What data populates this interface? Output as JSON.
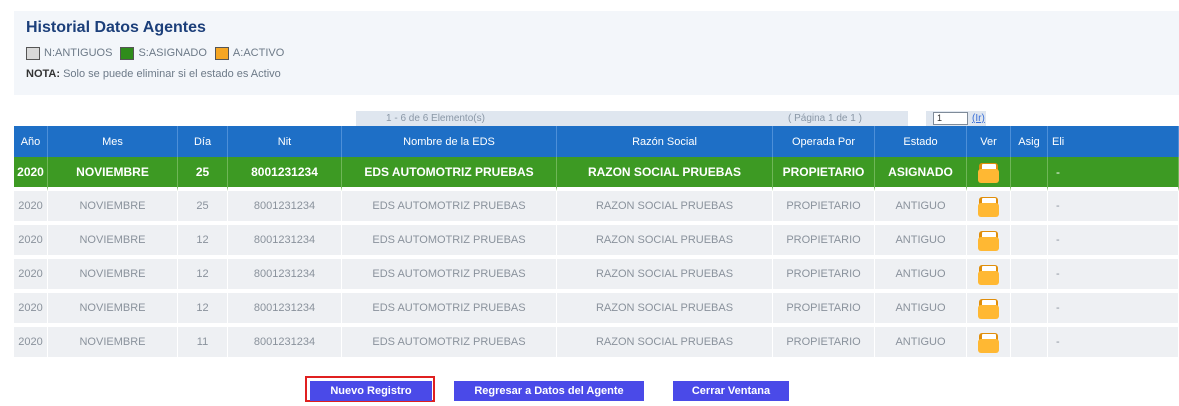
{
  "page": {
    "title": "Historial Datos Agentes"
  },
  "legend": [
    {
      "code": "N",
      "label": "N:ANTIGUOS",
      "color": "#d9d9d9"
    },
    {
      "code": "S",
      "label": "S:ASIGNADO",
      "color": "#2f8c1b"
    },
    {
      "code": "A",
      "label": "A:ACTIVO",
      "color": "#f5a623"
    }
  ],
  "note": {
    "label": "NOTA:",
    "text": "Solo se puede eliminar si el estado es Activo"
  },
  "pager": {
    "range": "1 - 6 de 6 Elemento(s)",
    "page": "( Página 1 de 1 )",
    "page_input": "1",
    "go": "(Ir)"
  },
  "table": {
    "headers": [
      "Año",
      "Mes",
      "Día",
      "Nit",
      "Nombre de la EDS",
      "Razón Social",
      "Operada Por",
      "Estado",
      "Ver",
      "Asig",
      "Eli"
    ],
    "rows": [
      {
        "anio": "2020",
        "mes": "NOVIEMBRE",
        "dia": "25",
        "nit": "8001231234",
        "nombre": "EDS AUTOMOTRIZ PRUEBAS",
        "razon": "RAZON SOCIAL PRUEBAS",
        "operada": "PROPIETARIO",
        "estado": "ASIGNADO",
        "asig": "",
        "eli": "-"
      },
      {
        "anio": "2020",
        "mes": "NOVIEMBRE",
        "dia": "25",
        "nit": "8001231234",
        "nombre": "EDS AUTOMOTRIZ PRUEBAS",
        "razon": "RAZON SOCIAL PRUEBAS",
        "operada": "PROPIETARIO",
        "estado": "ANTIGUO",
        "asig": "",
        "eli": "-"
      },
      {
        "anio": "2020",
        "mes": "NOVIEMBRE",
        "dia": "12",
        "nit": "8001231234",
        "nombre": "EDS AUTOMOTRIZ PRUEBAS",
        "razon": "RAZON SOCIAL PRUEBAS",
        "operada": "PROPIETARIO",
        "estado": "ANTIGUO",
        "asig": "",
        "eli": "-"
      },
      {
        "anio": "2020",
        "mes": "NOVIEMBRE",
        "dia": "12",
        "nit": "8001231234",
        "nombre": "EDS AUTOMOTRIZ PRUEBAS",
        "razon": "RAZON SOCIAL PRUEBAS",
        "operada": "PROPIETARIO",
        "estado": "ANTIGUO",
        "asig": "",
        "eli": "-"
      },
      {
        "anio": "2020",
        "mes": "NOVIEMBRE",
        "dia": "12",
        "nit": "8001231234",
        "nombre": "EDS AUTOMOTRIZ PRUEBAS",
        "razon": "RAZON SOCIAL PRUEBAS",
        "operada": "PROPIETARIO",
        "estado": "ANTIGUO",
        "asig": "",
        "eli": "-"
      },
      {
        "anio": "2020",
        "mes": "NOVIEMBRE",
        "dia": "11",
        "nit": "8001231234",
        "nombre": "EDS AUTOMOTRIZ PRUEBAS",
        "razon": "RAZON SOCIAL PRUEBAS",
        "operada": "PROPIETARIO",
        "estado": "ANTIGUO",
        "asig": "",
        "eli": "-"
      }
    ],
    "ver_icon": "folder-icon"
  },
  "actions": {
    "nuevo": "Nuevo Registro",
    "regresar": "Regresar a Datos del Agente",
    "cerrar": "Cerrar Ventana"
  },
  "colors": {
    "header_blue": "#1e6fc6",
    "asignado_green": "#3d9a23",
    "button_blue": "#4a4ae8",
    "highlight_red": "#e02020"
  }
}
